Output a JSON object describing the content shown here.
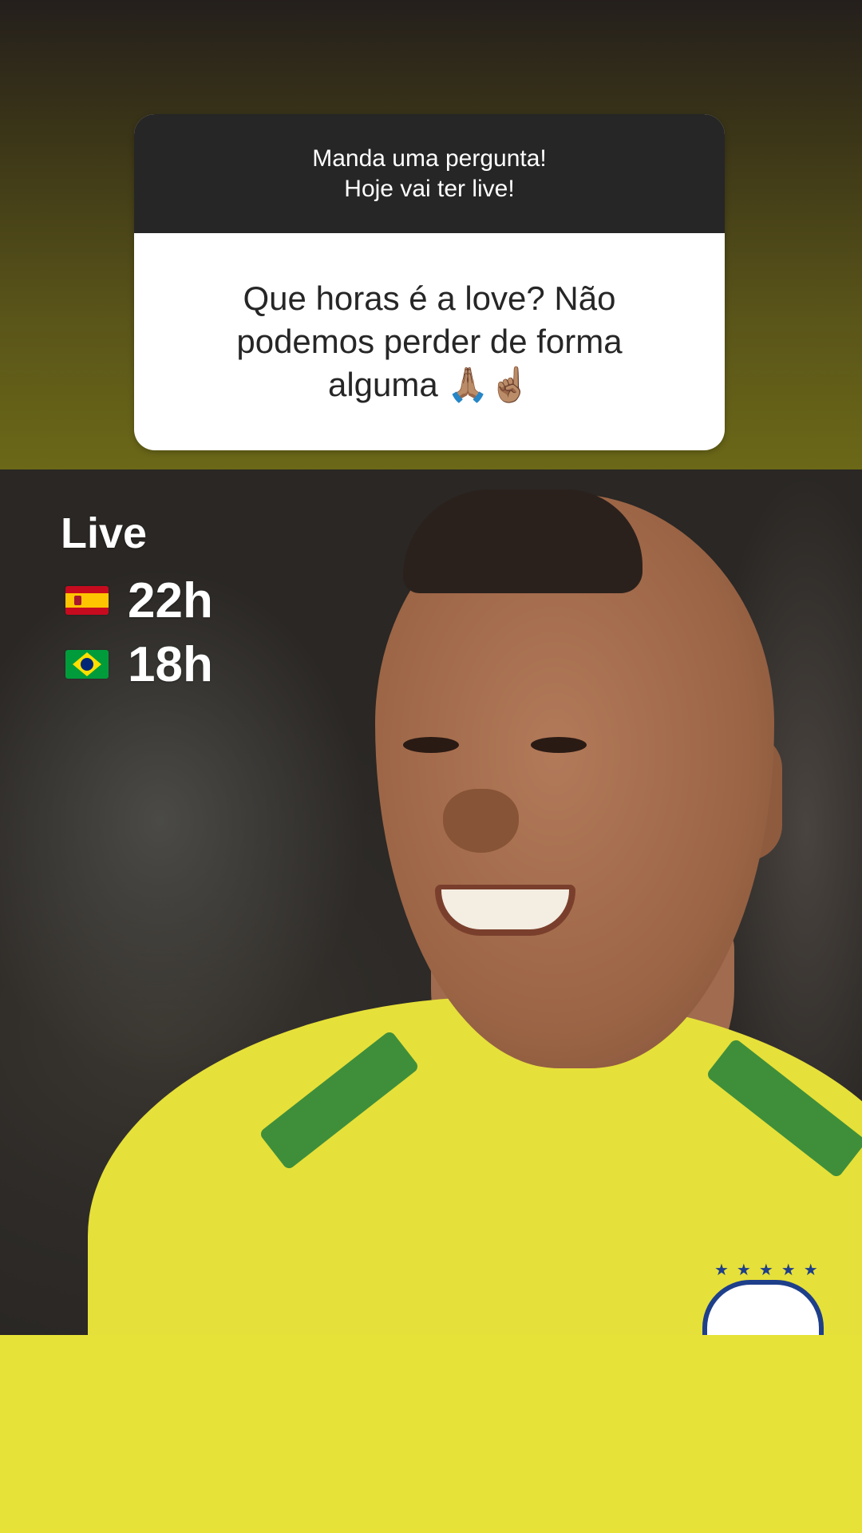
{
  "question_sticker": {
    "prompt_line_1": "Manda uma pergunta!",
    "prompt_line_2": "Hoje vai ter live!",
    "answer_text": "Que horas é a love? Não podemos perder de forma alguma 🙏🏽☝🏽"
  },
  "live_info": {
    "title": "Live",
    "schedule": [
      {
        "flag_icon": "spain-flag-icon",
        "time": "22h"
      },
      {
        "flag_icon": "brazil-flag-icon",
        "time": "18h"
      }
    ]
  },
  "colors": {
    "sticker_header": "#262626",
    "sticker_body": "#ffffff",
    "jersey_yellow": "#e6e03a",
    "jersey_green": "#3f8f3a",
    "bottom_band": "#e6e237"
  }
}
